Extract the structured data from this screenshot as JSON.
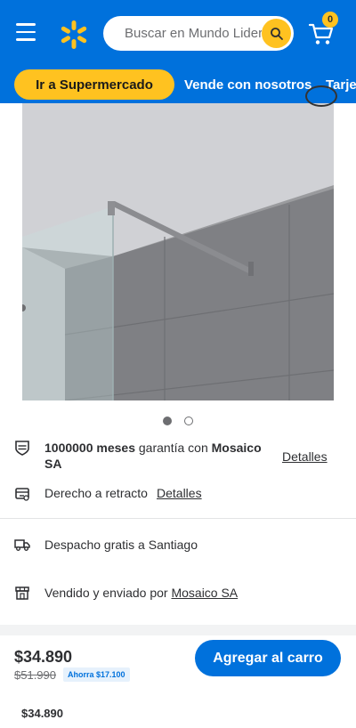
{
  "header": {
    "search_placeholder": "Buscar en Mundo Lider",
    "cart_count": "0"
  },
  "nav": {
    "primary": "Ir a Supermercado",
    "links": [
      "Vende con nosotros",
      "Tarje"
    ]
  },
  "product": {
    "carousel": {
      "count": 2,
      "active_index": 0
    }
  },
  "info": {
    "warranty": {
      "strong_1": "1000000 meses",
      "text": " garantía con ",
      "strong_2": "Mosaico",
      "line2": "SA",
      "link": "Detalles"
    },
    "retract": {
      "text": "Derecho a retracto",
      "link": "Detalles"
    },
    "shipping": {
      "text": "Despacho gratis a Santiago"
    },
    "seller": {
      "text": "Vendido y enviado por ",
      "link": "Mosaico SA"
    }
  },
  "purchase": {
    "price": "$34.890",
    "was_price": "$51.990",
    "savings": "Ahorra $17.100",
    "button": "Agregar al carro",
    "footer_price": "$34.890"
  },
  "colors": {
    "brand_blue": "#0071dc",
    "brand_yellow": "#ffc220"
  }
}
